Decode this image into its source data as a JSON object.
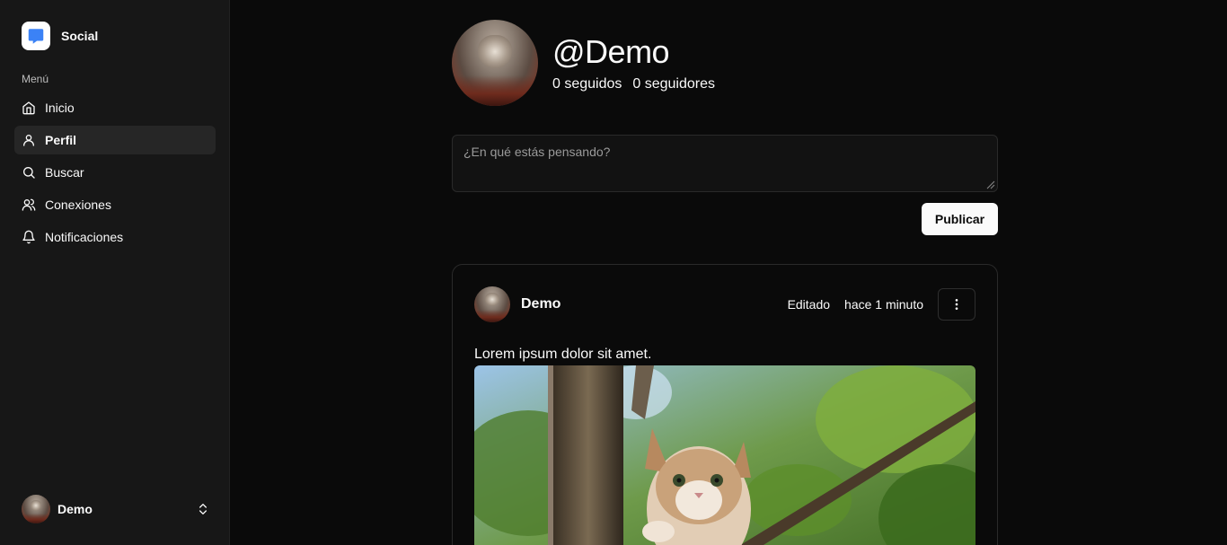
{
  "app": {
    "name": "Social"
  },
  "sidebar": {
    "menu_label": "Menú",
    "items": [
      {
        "label": "Inicio",
        "icon": "home-icon",
        "active": false
      },
      {
        "label": "Perfil",
        "icon": "user-icon",
        "active": true
      },
      {
        "label": "Buscar",
        "icon": "search-icon",
        "active": false
      },
      {
        "label": "Conexiones",
        "icon": "users-icon",
        "active": false
      },
      {
        "label": "Notificaciones",
        "icon": "bell-icon",
        "active": false
      }
    ],
    "user": {
      "name": "Demo"
    }
  },
  "profile": {
    "handle": "@Demo",
    "following": "0 seguidos",
    "followers": "0 seguidores"
  },
  "composer": {
    "placeholder": "¿En qué estás pensando?",
    "publish_label": "Publicar"
  },
  "post": {
    "author": "Demo",
    "edited_label": "Editado",
    "time": "hace 1 minuto",
    "text": "Lorem ipsum dolor sit amet."
  },
  "colors": {
    "background": "#0a0a0a",
    "sidebar": "#171717",
    "active_item": "#262626",
    "text": "#fafafa",
    "brand_icon": "#3b82f6"
  }
}
